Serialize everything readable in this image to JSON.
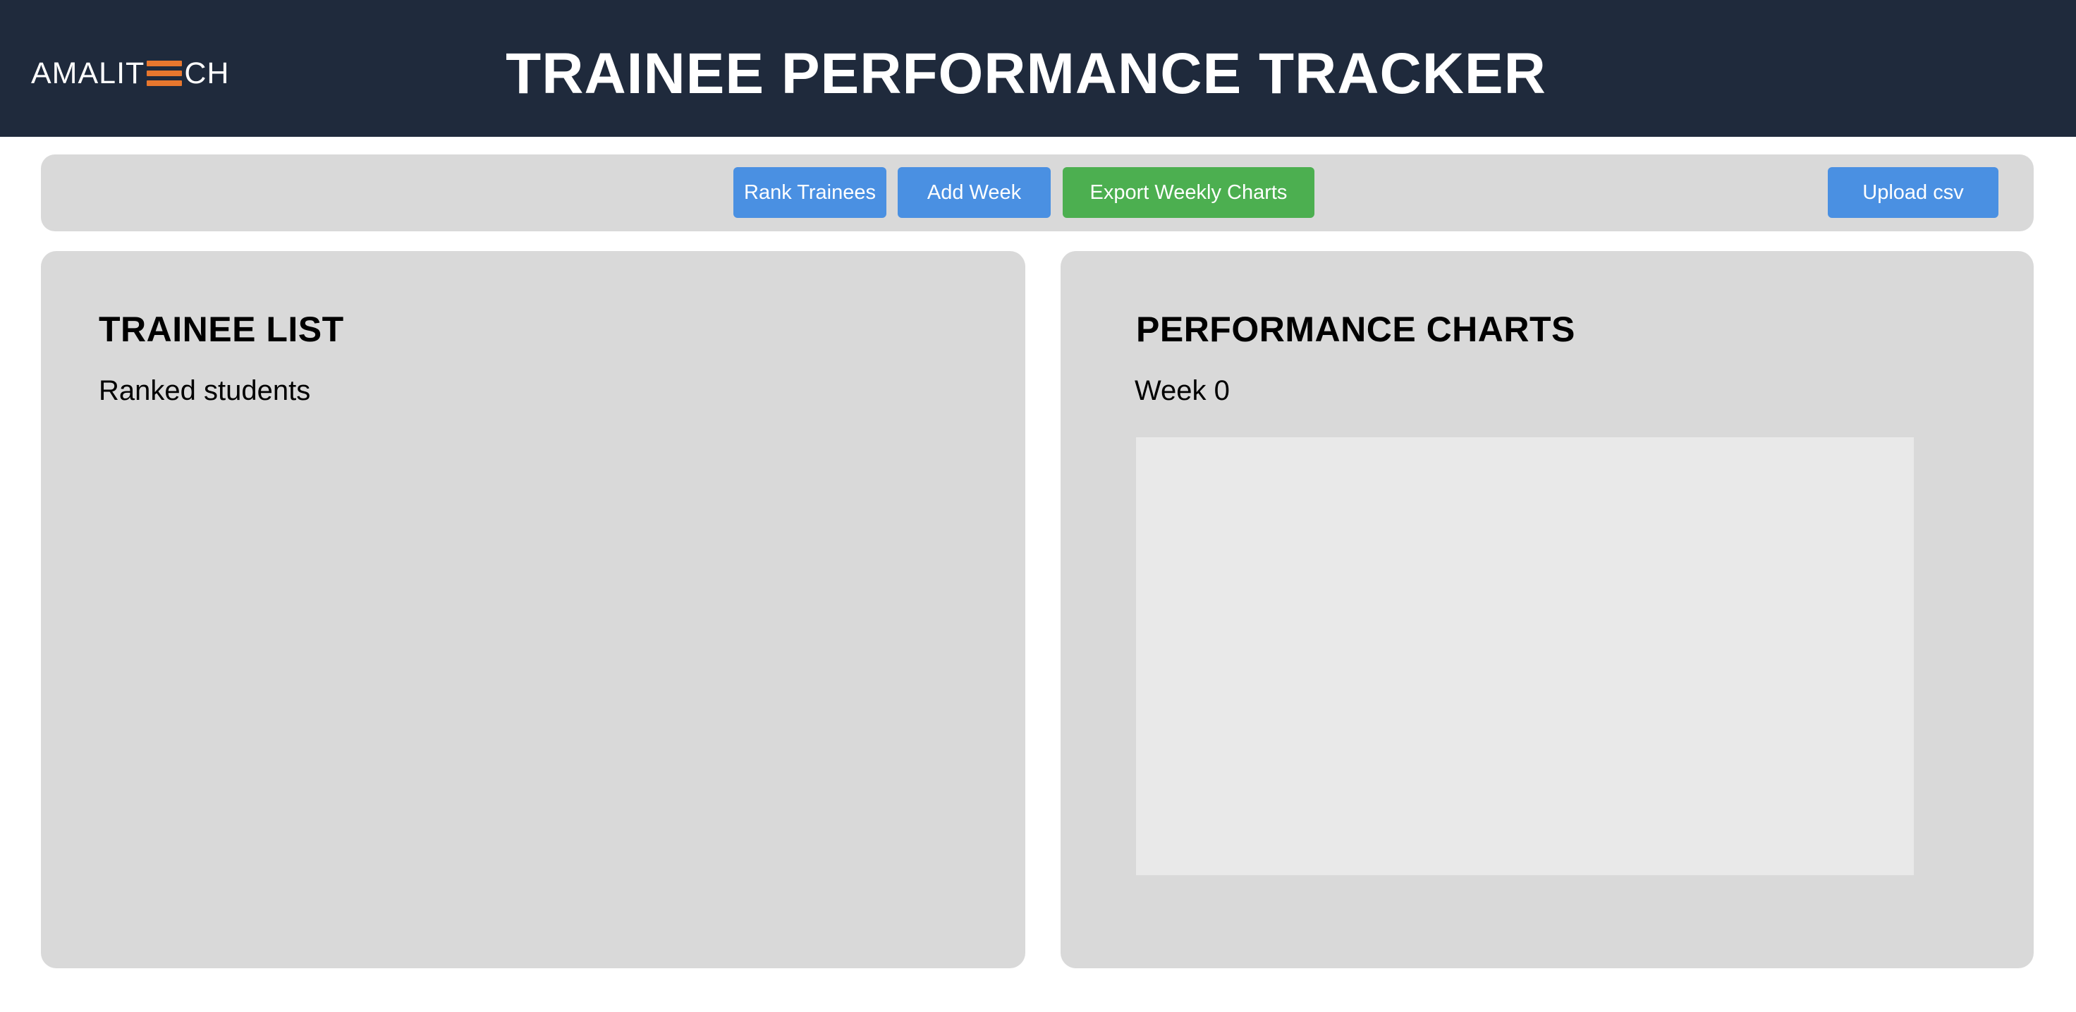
{
  "header": {
    "logo_left": "AMALIT",
    "logo_right": "CH",
    "title": "TRAINEE PERFORMANCE TRACKER"
  },
  "toolbar": {
    "rank_label": "Rank Trainees",
    "add_week_label": "Add Week",
    "export_label": "Export Weekly Charts",
    "upload_label": "Upload csv"
  },
  "trainee_panel": {
    "title": "TRAINEE LIST",
    "subtitle": "Ranked students"
  },
  "charts_panel": {
    "title": "PERFORMANCE CHARTS",
    "week_label": "Week 0"
  },
  "colors": {
    "header_bg": "#1f2a3c",
    "logo_accent": "#e8772e",
    "button_blue": "#4a90e2",
    "button_green": "#4caf50",
    "panel_bg": "#d9d9d9",
    "chart_bg": "#e9e9e9"
  }
}
